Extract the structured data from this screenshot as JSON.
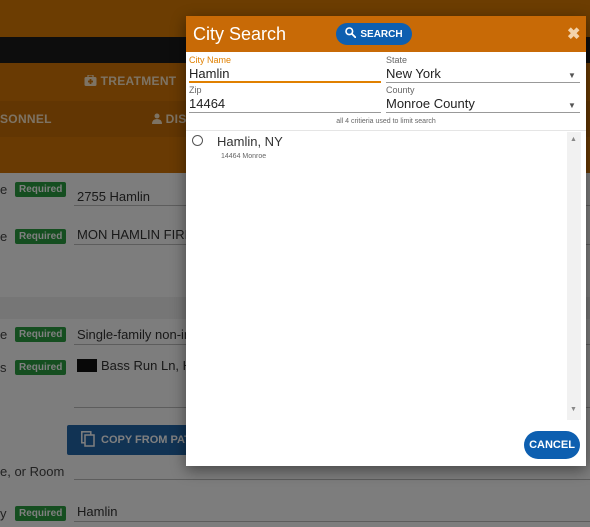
{
  "background": {
    "nav": {
      "treatment": "TREATMENT",
      "personnel": "SONNEL",
      "dis": "DIS"
    },
    "rows": [
      {
        "label": "e",
        "required": "Required",
        "value": "2755 Hamlin"
      },
      {
        "label": "e",
        "required": "Required",
        "value": "MON HAMLIN FIRE"
      },
      {
        "label": "e",
        "required": "Required",
        "value": "Single-family non-in"
      },
      {
        "label": "s",
        "required": "Required",
        "value": "Bass Run Ln, H"
      },
      {
        "label": "e, or Room",
        "required": "",
        "value": ""
      },
      {
        "label": "y",
        "required": "Required",
        "value": "Hamlin"
      }
    ],
    "copy_button": "COPY FROM PAT"
  },
  "modal": {
    "title": "City Search",
    "search_button": "SEARCH",
    "close": "✖",
    "city_label": "City Name",
    "city_value": "Hamlin",
    "state_label": "State",
    "state_value": "New York",
    "zip_label": "Zip",
    "zip_value": "14464",
    "county_label": "County",
    "county_value": "Monroe County",
    "hint": "all 4 critieria used to limit search",
    "results": [
      {
        "name": "Hamlin, NY",
        "sub": "14464 Monroe"
      }
    ],
    "cancel_button": "CANCEL"
  },
  "icons": {
    "treatment": "medical-kit-icon",
    "dis": "person-icon",
    "search": "search-icon",
    "copy": "copy-icon",
    "close": "close-icon",
    "dropdown": "dropdown-caret-icon"
  },
  "colors": {
    "header_orange": "#c86a06",
    "button_blue": "#0d5fb0",
    "required_green": "#2a9c41",
    "active_orange": "#e08000"
  }
}
